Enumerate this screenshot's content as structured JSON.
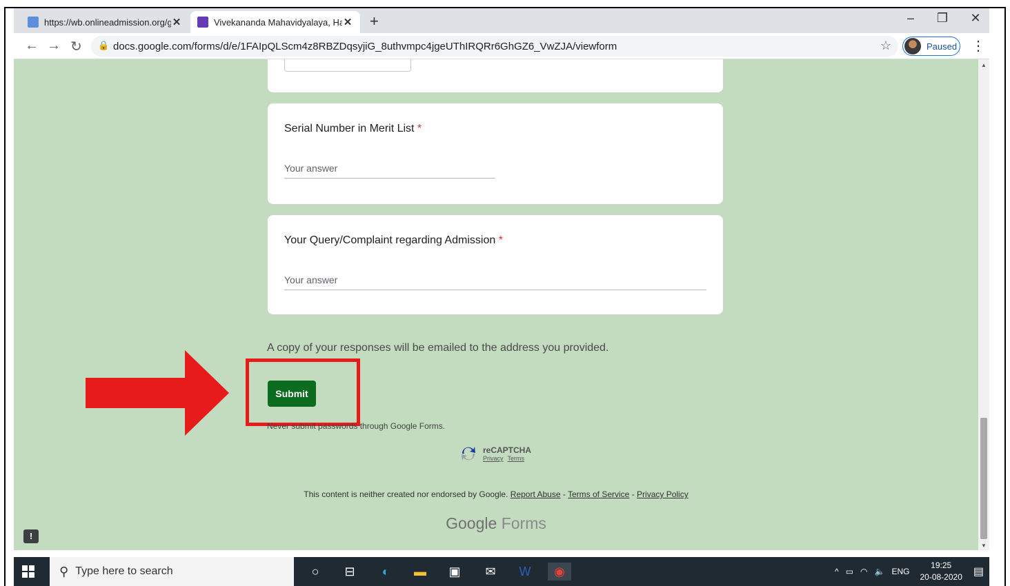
{
  "browser": {
    "tabs": [
      {
        "title": "https://wb.onlineadmission.org/g",
        "active": false
      },
      {
        "title": "Vivekananda Mahavidyalaya, Har",
        "active": true
      }
    ],
    "new_tab": "+",
    "close": "✕",
    "url": "docs.google.com/forms/d/e/1FAIpQLScm4z8RBZDqsyjiG_8uthvmpc4jgeUThIRQRr6GhGZ6_VwZJA/viewform",
    "profile_label": "Paused"
  },
  "form": {
    "questions": [
      {
        "title": "Serial Number in Merit List",
        "required_mark": "*",
        "placeholder": "Your answer"
      },
      {
        "title": "Your Query/Complaint regarding Admission",
        "required_mark": "*",
        "placeholder": "Your answer"
      }
    ],
    "copy_note": "A copy of your responses will be emailed to the address you provided.",
    "submit_label": "Submit",
    "never_submit": "Never submit passwords through Google Forms.",
    "recaptcha": {
      "title": "reCAPTCHA",
      "privacy": "Privacy",
      "terms": "Terms"
    },
    "disclaimer": {
      "text": "This content is neither created nor endorsed by Google.",
      "report_abuse": "Report Abuse",
      "sep": "-",
      "terms": "Terms of Service",
      "privacy": "Privacy Policy"
    },
    "brand": {
      "google": "Google",
      "forms": "Forms"
    },
    "feedback_icon": "!"
  },
  "annotation": {
    "arrow_color": "#e81b1b",
    "box_color": "#e81b1b"
  },
  "taskbar": {
    "search_placeholder": "Type here to search",
    "tray": {
      "lang": "ENG",
      "time": "19:25",
      "date": "20-08-2020"
    }
  },
  "colors": {
    "page_bg": "#c3dbbf",
    "submit_bg": "#0b6b1f",
    "required": "#d93025"
  }
}
